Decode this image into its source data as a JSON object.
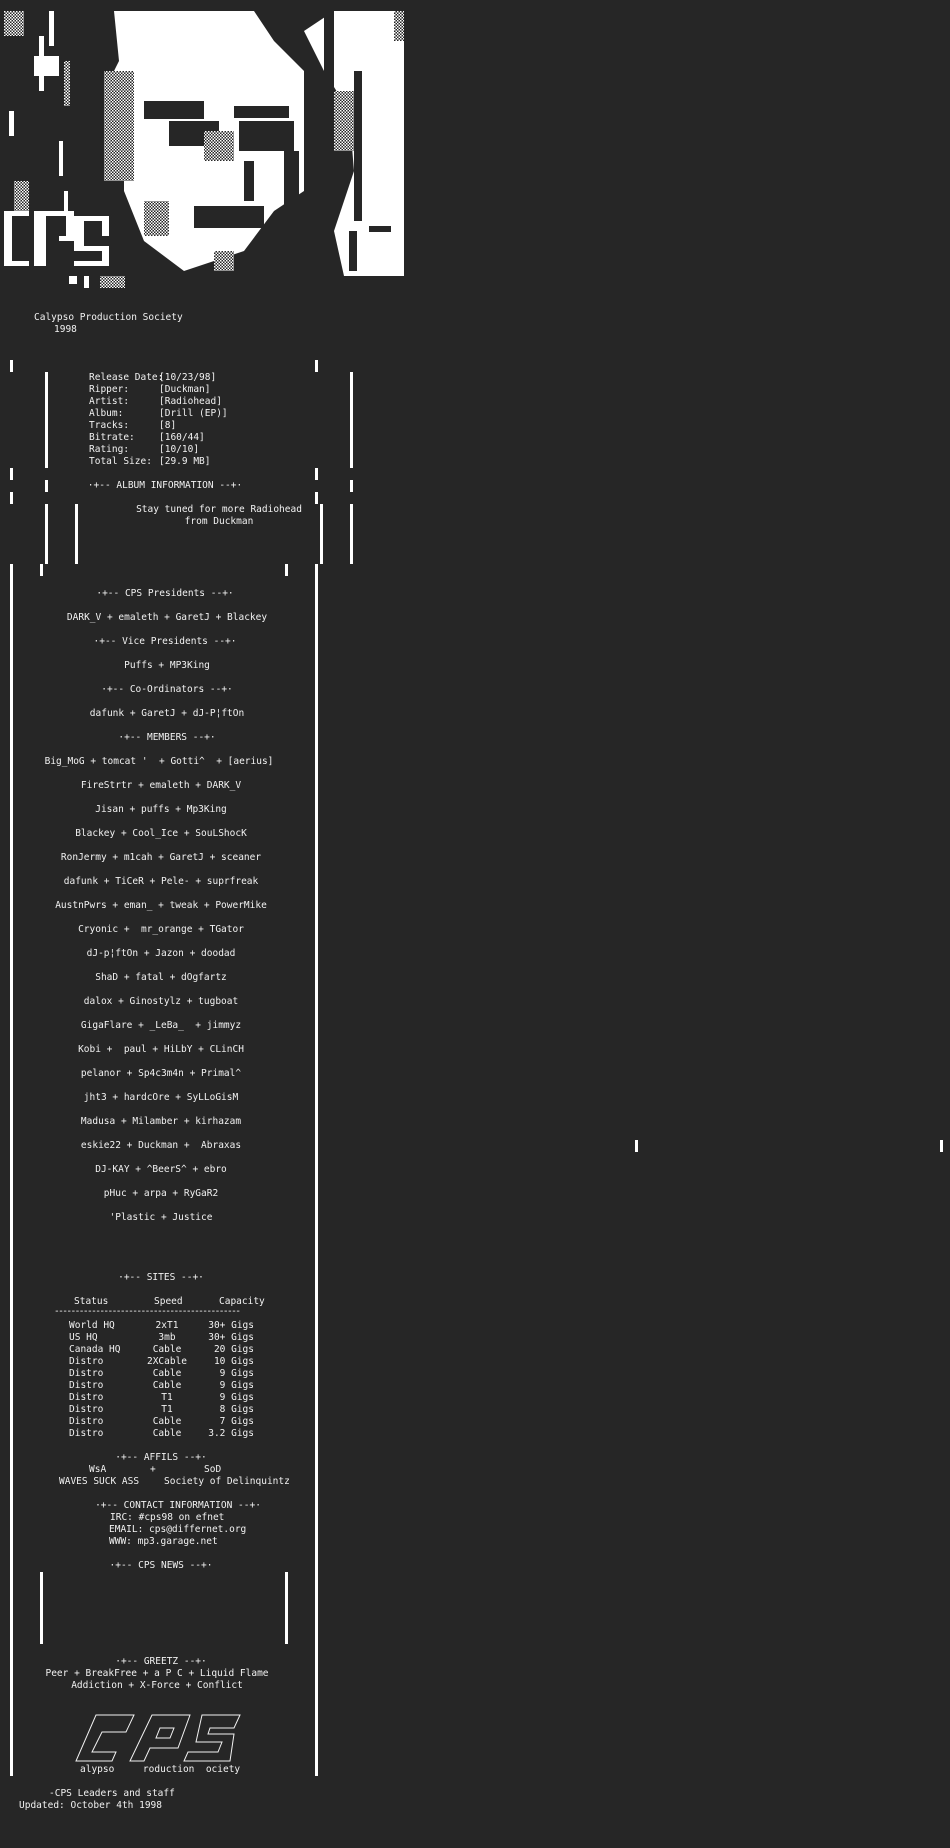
{
  "header": {
    "group_name": "Calypso Production Society",
    "year": "1998"
  },
  "release": {
    "fields": [
      {
        "label": "Release Date:",
        "value": "[10/23/98]"
      },
      {
        "label": "Ripper:",
        "value": "[Duckman]"
      },
      {
        "label": "Artist:",
        "value": "[Radiohead]"
      },
      {
        "label": "Album:",
        "value": "[Drill (EP)]"
      },
      {
        "label": "Tracks:",
        "value": "[8]"
      },
      {
        "label": "Bitrate:",
        "value": "[160/44]"
      },
      {
        "label": "Rating:",
        "value": "[10/10]"
      },
      {
        "label": "Total Size:",
        "value": "[29.9 MB]"
      }
    ]
  },
  "album_info": {
    "heading": "·+-- ALBUM INFORMATION --+·",
    "lines": [
      "Stay tuned for more Radiohead",
      "from Duckman"
    ]
  },
  "presidents": {
    "heading": "·+-- CPS Presidents --+·",
    "names": "DARK_V + emaleth + GaretJ + Blackey"
  },
  "vice_presidents": {
    "heading": "·+-- Vice Presidents --+·",
    "names": "Puffs + MP3King"
  },
  "coordinators": {
    "heading": "·+-- Co-Ordinators --+·",
    "names": "dafunk + GaretJ + dJ-P¦ftOn"
  },
  "members": {
    "heading": "·+-- MEMBERS --+·",
    "rows": [
      "Big_MoG + tomcat '  + Gotti^  + [aerius]",
      "FireStrtr + emaleth + DARK_V",
      "Jisan + puffs + Mp3King",
      "Blackey + Cool_Ice + SouLShocK",
      "RonJermy + m1cah + GaretJ + sceaner",
      "dafunk + TiCeR + Pele- + suprfreak",
      "AustnPwrs + eman_ + tweak + PowerMike",
      "Cryonic +  mr_orange + TGator",
      "dJ-p¦ftOn + Jazon + doodad",
      "ShaD + fatal + dOgfartz",
      "dalox + Ginostylz + tugboat",
      "GigaFlare + _LeBa_  + jimmyz",
      "Kobi +  paul + HiLbY + CLinCH",
      "pelanor + Sp4c3m4n + Primal^",
      "jht3 + hardcOre + SyLLoGisM",
      "Madusa + Milamber + kirhazam",
      "eskie22 + Duckman +  Abraxas",
      "DJ-KAY + ^BeerS^ + ebro",
      "pHuc + arpa + RyGaR2",
      "'Plastic + Justice"
    ]
  },
  "sites": {
    "heading": "·+-- SITES --+·",
    "columns": [
      "Status",
      "Speed",
      "Capacity"
    ],
    "divider": "---------------------------------------------",
    "rows": [
      {
        "status": "World HQ",
        "speed": "2xT1",
        "capacity": "30+ Gigs"
      },
      {
        "status": "US HQ",
        "speed": "3mb",
        "capacity": "30+ Gigs"
      },
      {
        "status": "Canada HQ",
        "speed": "Cable",
        "capacity": "20 Gigs"
      },
      {
        "status": "Distro",
        "speed": "2XCable",
        "capacity": "10 Gigs"
      },
      {
        "status": "Distro",
        "speed": "Cable",
        "capacity": "9 Gigs"
      },
      {
        "status": "Distro",
        "speed": "Cable",
        "capacity": "9 Gigs"
      },
      {
        "status": "Distro",
        "speed": "T1",
        "capacity": "9 Gigs"
      },
      {
        "status": "Distro",
        "speed": "T1",
        "capacity": "8 Gigs"
      },
      {
        "status": "Distro",
        "speed": "Cable",
        "capacity": "7 Gigs"
      },
      {
        "status": "Distro",
        "speed": "Cable",
        "capacity": "3.2 Gigs"
      }
    ]
  },
  "affils": {
    "heading": "·+-- AFFILS --+·",
    "left_short": "WsA",
    "separator": "+",
    "right_short": "SoD",
    "left_long": "WAVES SUCK ASS",
    "right_long": "Society of Delinquintz"
  },
  "contact": {
    "heading": "·+-- CONTACT INFORMATION --+·",
    "irc": "IRC: #cps98 on efnet",
    "email": "EMAIL: cps@differnet.org",
    "www": "WWW: mp3.garage.net"
  },
  "news": {
    "heading": "·+-- CPS NEWS --+·"
  },
  "greetz": {
    "heading": "·+-- GREETZ --+·",
    "line1": "Peer + BreakFree + a P C + Liquid Flame",
    "line2": "Addiction + X-Force + Conflict"
  },
  "footer_logo": {
    "art": [
      "    _________    _________    _________",
      "   /  _____ /   /  ____  /   / _______/",
      "  /  /    //   /  / __/ /   / |       ",
      " /  /    //   /  / /__ /   /  |______ ",
      "/  /____//   /  /____ /   /_\\___    /",
      "\\_______/   /__/      \\  /_________/ "
    ],
    "tagline": "alypso     roduction  ociety"
  },
  "signoff": {
    "line1": "-CPS Leaders and staff",
    "line2": "Updated: October 4th 1998"
  },
  "colors": {
    "background": "#262626",
    "text": "#f2f2f2",
    "art_light": "#ffffff"
  }
}
